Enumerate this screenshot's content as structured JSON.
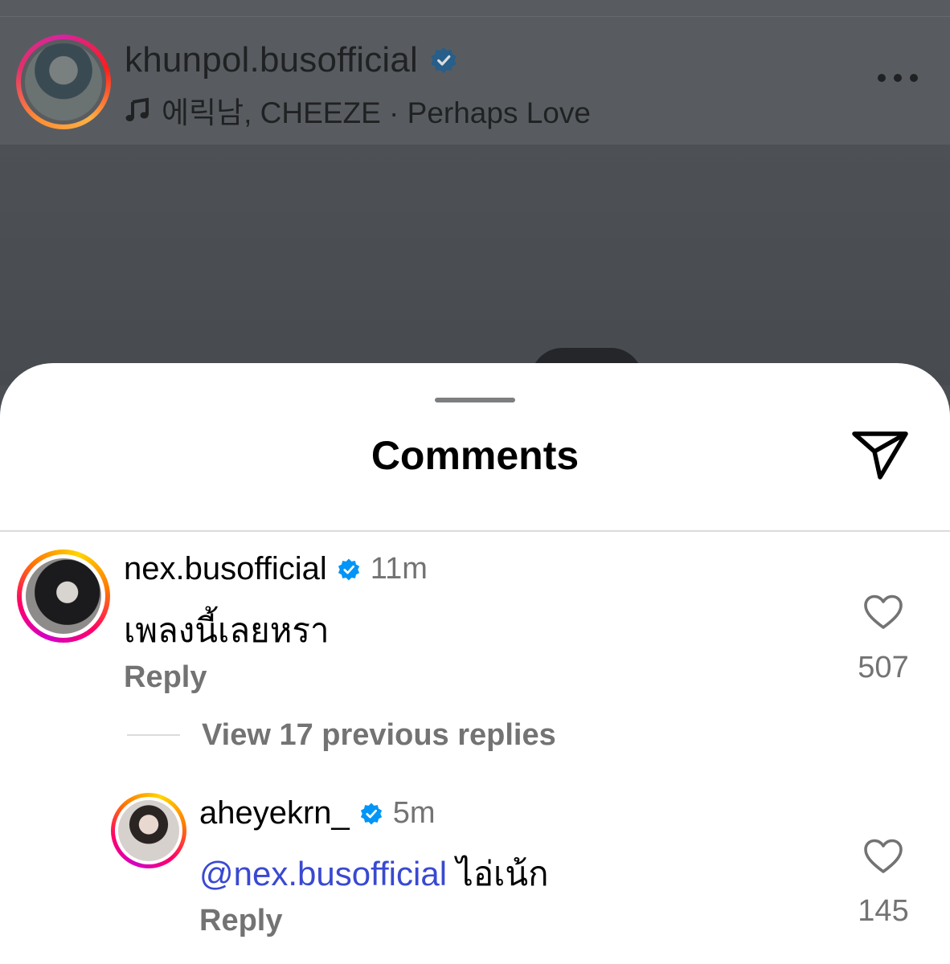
{
  "story": {
    "username": "khunpol.busofficial",
    "verified": true,
    "music": "에릭남, CHEEZE · Perhaps Love",
    "music_icon": "music-note-icon",
    "more_icon": "more-horizontal-icon"
  },
  "sheet": {
    "title": "Comments",
    "share_icon": "send-icon"
  },
  "comments": [
    {
      "username": "nex.busofficial",
      "verified": true,
      "time": "11m",
      "text": "เพลงนี้เลยหรา",
      "reply_label": "Reply",
      "likes": "507",
      "view_replies": "View 17 previous replies"
    },
    {
      "username": "aheyekrn_",
      "verified": true,
      "time": "5m",
      "mention": "@nex.busofficial",
      "text": "ไอ่เน้ก",
      "reply_label": "Reply",
      "likes": "145"
    }
  ],
  "colors": {
    "verified": "#0095f6",
    "mention": "#3949d1",
    "secondary_text": "#737373"
  }
}
